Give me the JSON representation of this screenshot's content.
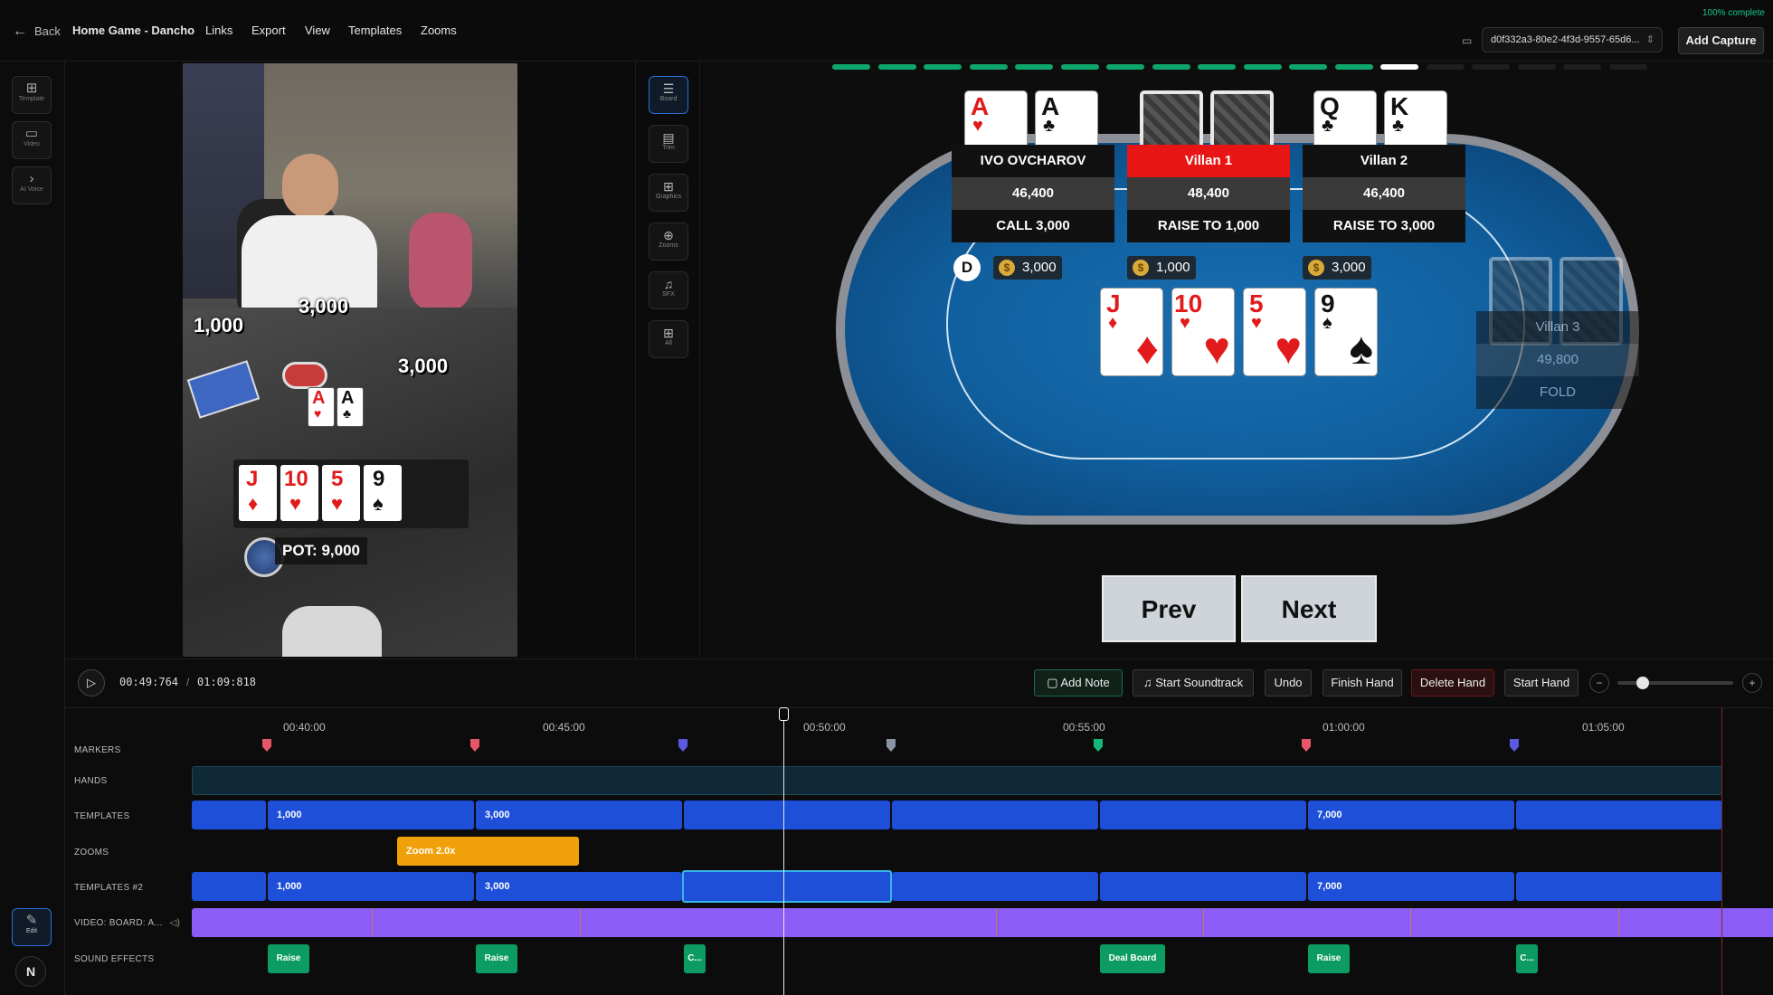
{
  "topbar": {
    "back_label": "Back",
    "project_title": "Home Game - Dancho",
    "menu": [
      "Links",
      "Export",
      "View",
      "Templates",
      "Zooms"
    ],
    "capture_id": "d0f332a3-80e2-4f3d-9557-65d6...",
    "add_capture_label": "Add Capture",
    "complete_label": "100% complete"
  },
  "left_rail": [
    {
      "label": "Template",
      "icon": "grid-icon"
    },
    {
      "label": "Video",
      "icon": "video-icon"
    },
    {
      "label": "AI Voice",
      "icon": "chevron-right-icon"
    }
  ],
  "left_rail_bottom": {
    "edit_label": "Edit",
    "logo": "N"
  },
  "video_overlay": {
    "bet_left": "1,000",
    "bet_top": "3,000",
    "bet_right": "3,000",
    "hole_cards": [
      {
        "rank": "A",
        "suit": "♥"
      },
      {
        "rank": "A",
        "suit": "♣"
      }
    ],
    "board_cards": [
      {
        "rank": "J",
        "suit": "♦"
      },
      {
        "rank": "10",
        "suit": "♥"
      },
      {
        "rank": "5",
        "suit": "♥"
      },
      {
        "rank": "9",
        "suit": "♠"
      }
    ],
    "pot_label": "POT: 9,000"
  },
  "tools": [
    {
      "label": "Board",
      "icon": "menu-icon",
      "active": true
    },
    {
      "label": "Trim",
      "icon": "trim-icon",
      "active": false
    },
    {
      "label": "Graphics",
      "icon": "grid-icon",
      "active": false
    },
    {
      "label": "Zooms",
      "icon": "zoom-icon",
      "active": false
    },
    {
      "label": "SFX",
      "icon": "speaker-icon",
      "active": false
    },
    {
      "label": "All",
      "icon": "grid-icon",
      "active": false
    }
  ],
  "board": {
    "dealer_label": "D",
    "players": [
      {
        "name": "IVO OVCHAROV",
        "stack": "46,400",
        "action": "CALL 3,000",
        "bet": "3,000",
        "highlight": false,
        "cards": [
          {
            "rank": "A",
            "suit": "♥"
          },
          {
            "rank": "A",
            "suit": "♣"
          }
        ]
      },
      {
        "name": "Villan 1",
        "stack": "48,400",
        "action": "RAISE TO 1,000",
        "bet": "1,000",
        "highlight": true,
        "cards": []
      },
      {
        "name": "Villan 2",
        "stack": "46,400",
        "action": "RAISE TO 3,000",
        "bet": "3,000",
        "highlight": false,
        "cards": [
          {
            "rank": "Q",
            "suit": "♣"
          },
          {
            "rank": "K",
            "suit": "♣"
          }
        ]
      },
      {
        "name": "Villan 3",
        "stack": "49,800",
        "action": "FOLD",
        "highlight": false,
        "folded": true
      }
    ],
    "community": [
      {
        "rank": "J",
        "suit": "♦"
      },
      {
        "rank": "10",
        "suit": "♥"
      },
      {
        "rank": "5",
        "suit": "♥"
      },
      {
        "rank": "9",
        "suit": "♠"
      }
    ],
    "prev_label": "Prev",
    "next_label": "Next",
    "progress_done": 13,
    "progress_total": 18,
    "accent": "#0ea66b",
    "highlight_color": "#e81515"
  },
  "timeline": {
    "current_time": "00:49:764",
    "separator": "/",
    "total_time": "01:09:818",
    "buttons": [
      "Add Note",
      "Start Soundtrack",
      "Undo",
      "Finish Hand",
      "Delete Hand",
      "Start Hand"
    ],
    "zoom_minus": "−",
    "zoom_plus": "+",
    "zoom_level": 0.18,
    "ticks": [
      "00:40:00",
      "00:45:00",
      "00:50:00",
      "00:55:00",
      "01:00:00",
      "01:05:00"
    ],
    "lanes": [
      "MARKERS",
      "HANDS",
      "TEMPLATES",
      "ZOOMS",
      "TEMPLATES #2",
      "VIDEO: BOARD: A...",
      "SOUND EFFECTS"
    ],
    "template_labels": [
      "1,000",
      "3,000",
      "",
      "",
      "",
      "7,000",
      ""
    ],
    "zoom_clip": "Zoom 2.0x",
    "sfx_clips": [
      "Raise",
      "Raise",
      "C...",
      "Deal Board",
      "Raise",
      "C..."
    ],
    "marker_colors": [
      "#e5566b",
      "#e5566b",
      "#5a5ae0",
      "#8a95a6",
      "#14b87a",
      "#e5566b",
      "#5a5ae0"
    ]
  }
}
